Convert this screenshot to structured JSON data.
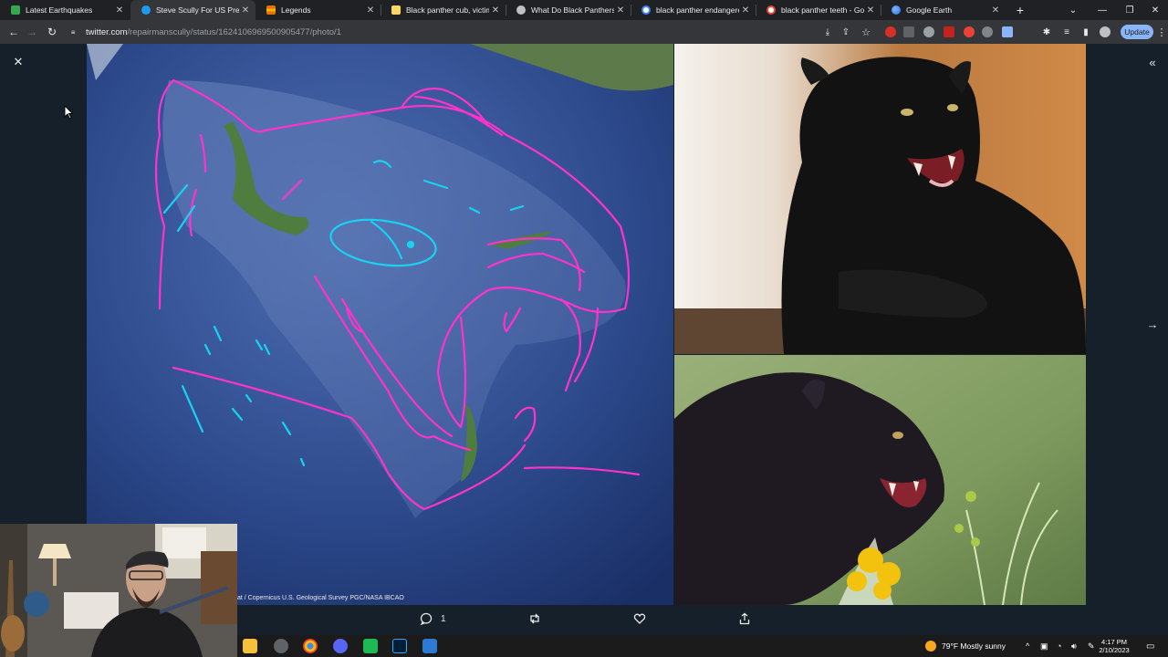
{
  "browser": {
    "tabs": [
      {
        "title": "Latest Earthquakes",
        "favicon_color": "#34a853",
        "active": false
      },
      {
        "title": "Steve Scully For US Preside",
        "favicon_color": "#1d9bf0",
        "active": true
      },
      {
        "title": "Legends",
        "favicon_color": "#f4b400",
        "active": false
      },
      {
        "title": "Black panther cub, victim",
        "favicon_color": "#fdd663",
        "active": false
      },
      {
        "title": "What Do Black Panthers E",
        "favicon_color": "#bdc1c6",
        "active": false
      },
      {
        "title": "black panther endangered",
        "favicon_color": "#ffffff",
        "active": false
      },
      {
        "title": "black panther teeth - Goo",
        "favicon_color": "#ffffff",
        "active": false
      },
      {
        "title": "Google Earth",
        "favicon_color": "#4285f4",
        "active": false
      }
    ],
    "new_tab_label": "+",
    "close_glyph": "✕",
    "url_host": "twitter.com",
    "url_path": "/repairmanscully/status/1624106969500905477/photo/1",
    "update_label": "Update"
  },
  "viewer": {
    "map_attribution": "at / Copernicus  U.S. Geological Survey  PGC/NASA  IBCAO",
    "reply_count": "1"
  },
  "taskbar": {
    "weather": "79°F  Mostly sunny",
    "time": "4:17 PM",
    "date": "2/10/2023"
  },
  "colors": {
    "map_ink_magenta": "#ff33cc",
    "map_ink_cyan": "#19d2f0",
    "accent_blue": "#1d9bf0"
  }
}
